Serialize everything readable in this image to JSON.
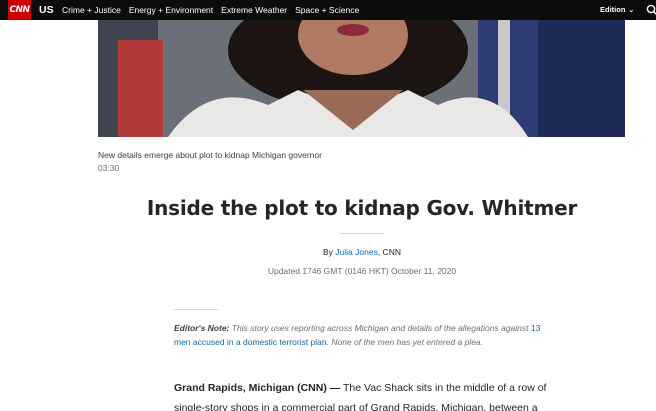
{
  "nav": {
    "logo": "CNN",
    "section": "US",
    "links": [
      "Crime + Justice",
      "Energy + Environment",
      "Extreme Weather",
      "Space + Science"
    ],
    "edition": "Edition",
    "icons": [
      "chevron-down-icon",
      "search-icon"
    ]
  },
  "video": {
    "caption": "New details emerge about plot to kidnap Michigan governor",
    "duration": "03:30"
  },
  "article": {
    "headline": "Inside the plot to kidnap Gov. Whitmer",
    "byline_prefix": "By ",
    "author": "Julia Jones",
    "byline_suffix": ", CNN",
    "updated": "Updated 1746 GMT (0146 HKT) October 11, 2020",
    "editors_note_label": "Editor's Note:",
    "editors_note_text_1": " This story uses reporting across Michigan and details of the allegations against ",
    "editors_note_link": "13 men accused in a domestic terrorist plan",
    "editors_note_text_2": ". None of the men has yet entered a plea.",
    "dateline": "Grand Rapids, Michigan (CNN) —",
    "body_text": " The Vac Shack sits in the middle of a row of single-story shops in a commercial part of Grand Rapids, Michigan, between a"
  },
  "colors": {
    "nav_bg": "#0c0c0c",
    "logo_red": "#cc0000",
    "link_blue": "#0c6aa6"
  }
}
